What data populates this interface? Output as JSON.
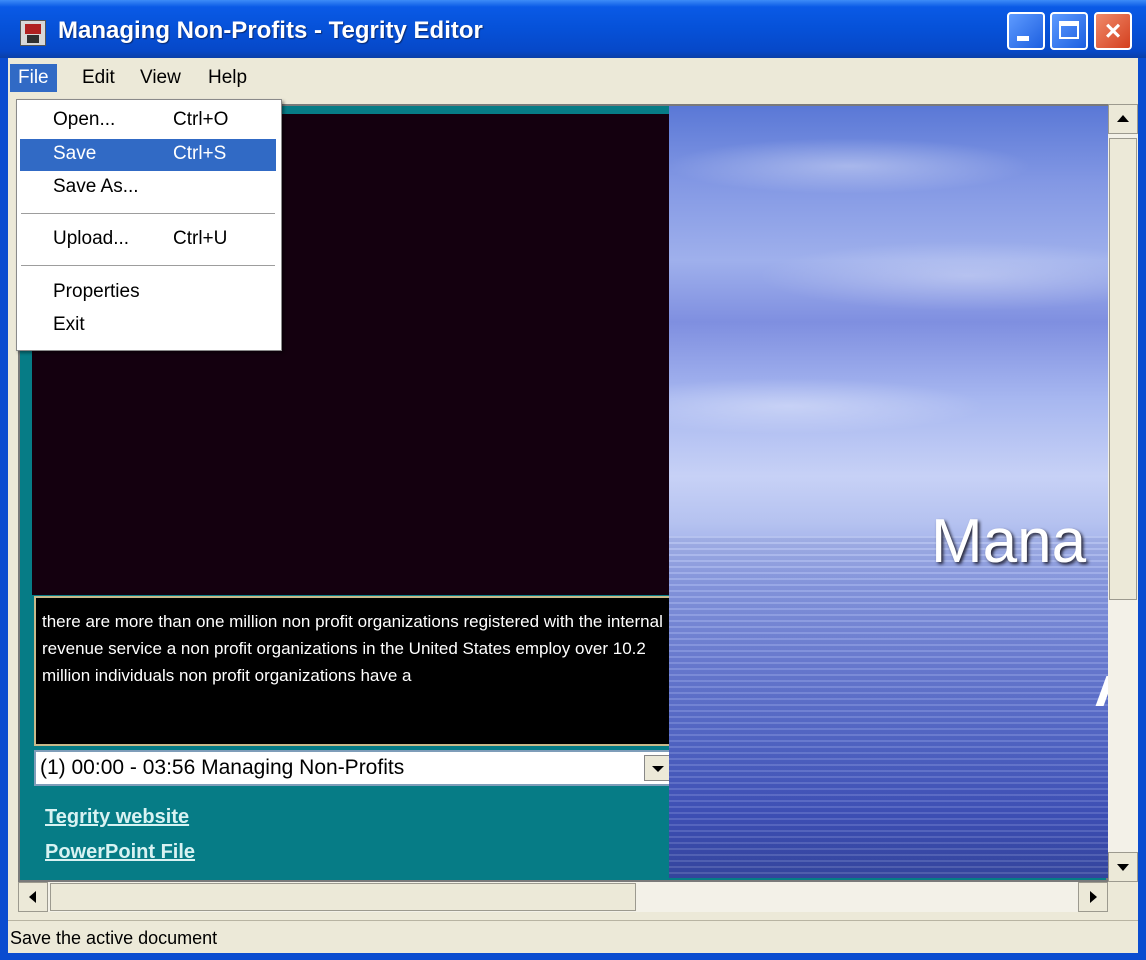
{
  "window": {
    "title": "Managing Non-Profits - Tegrity Editor"
  },
  "menubar": {
    "file": "File",
    "edit": "Edit",
    "view": "View",
    "help": "Help"
  },
  "file_menu": {
    "items": [
      {
        "label": "Open...",
        "shortcut": "Ctrl+O"
      },
      {
        "label": "Save",
        "shortcut": "Ctrl+S",
        "highlighted": true
      },
      {
        "label": "Save As...",
        "shortcut": ""
      },
      {
        "label": "Upload...",
        "shortcut": "Ctrl+U"
      },
      {
        "label": "Properties",
        "shortcut": ""
      },
      {
        "label": "Exit",
        "shortcut": ""
      }
    ]
  },
  "caption": {
    "text": "there are more than one million non profit organizations registered with the internal revenue service a non profit organizations in the United States employ over 10.2 million individuals non profit organizations have a"
  },
  "chapter_select": {
    "value": "(1) 00:00 - 03:56 Managing Non-Profits"
  },
  "links": {
    "website": "Tegrity website",
    "powerpoint": "PowerPoint File"
  },
  "slide": {
    "title_fragment": "Mana"
  },
  "statusbar": {
    "text": "Save the active document"
  },
  "colors": {
    "titlebar": "#0651d8",
    "menu_highlight": "#316ac5",
    "panel": "#067c86",
    "chrome": "#ece9d8"
  }
}
